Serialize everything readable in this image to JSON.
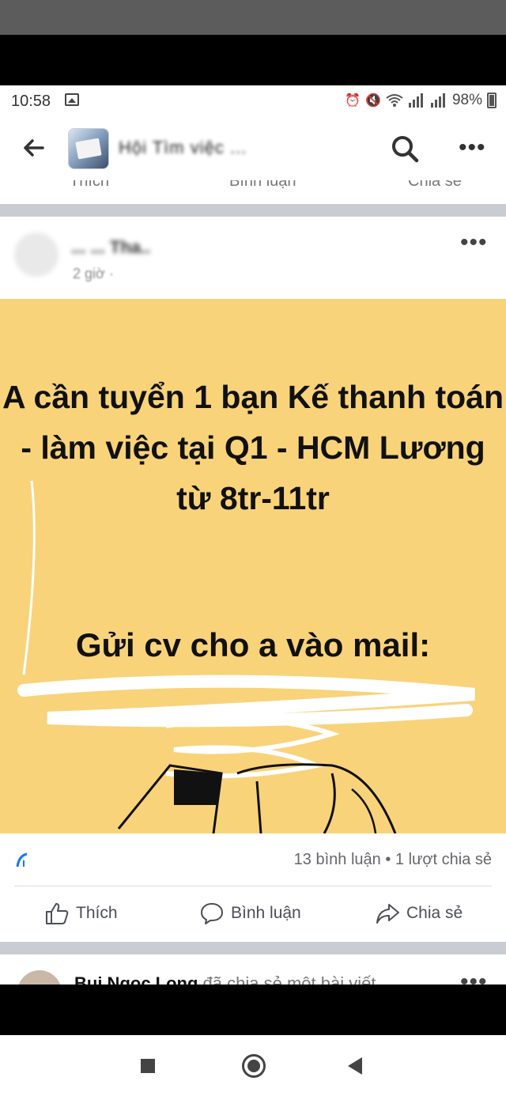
{
  "status_bar": {
    "time": "10:58",
    "battery": "98%",
    "icons": [
      "gallery-icon",
      "alarm-icon",
      "mute-icon",
      "wifi-icon",
      "signal-icon",
      "battery-icon"
    ]
  },
  "app_bar": {
    "group_name": "Hội Tìm việc ... ",
    "icons": [
      "arrow-left-icon",
      "search-icon",
      "more-horizontal-icon"
    ]
  },
  "previous_post_actions": [
    "Thích",
    "Bình luận",
    "Chia sẻ"
  ],
  "post": {
    "author": "... ... Tha..",
    "time": "2 giờ ·",
    "headline": "A cần tuyển 1 bạn Kế thanh toán - làm việc tại Q1 - HCM Lương từ 8tr-11tr",
    "mail_line": "Gửi cv cho a vào mail:",
    "counts": "13 bình luận • 1 lượt chia sẻ",
    "actions": {
      "like": "Thích",
      "comment": "Bình luận",
      "share": "Chia sẻ"
    }
  },
  "next_post": {
    "author": "Bui Ngoc Long",
    "text": "đã chia sẻ một bài viết"
  },
  "colors": {
    "post_background": "#f9d37a",
    "separator": "#c9ccd1",
    "action_text": "#4b4f56"
  }
}
